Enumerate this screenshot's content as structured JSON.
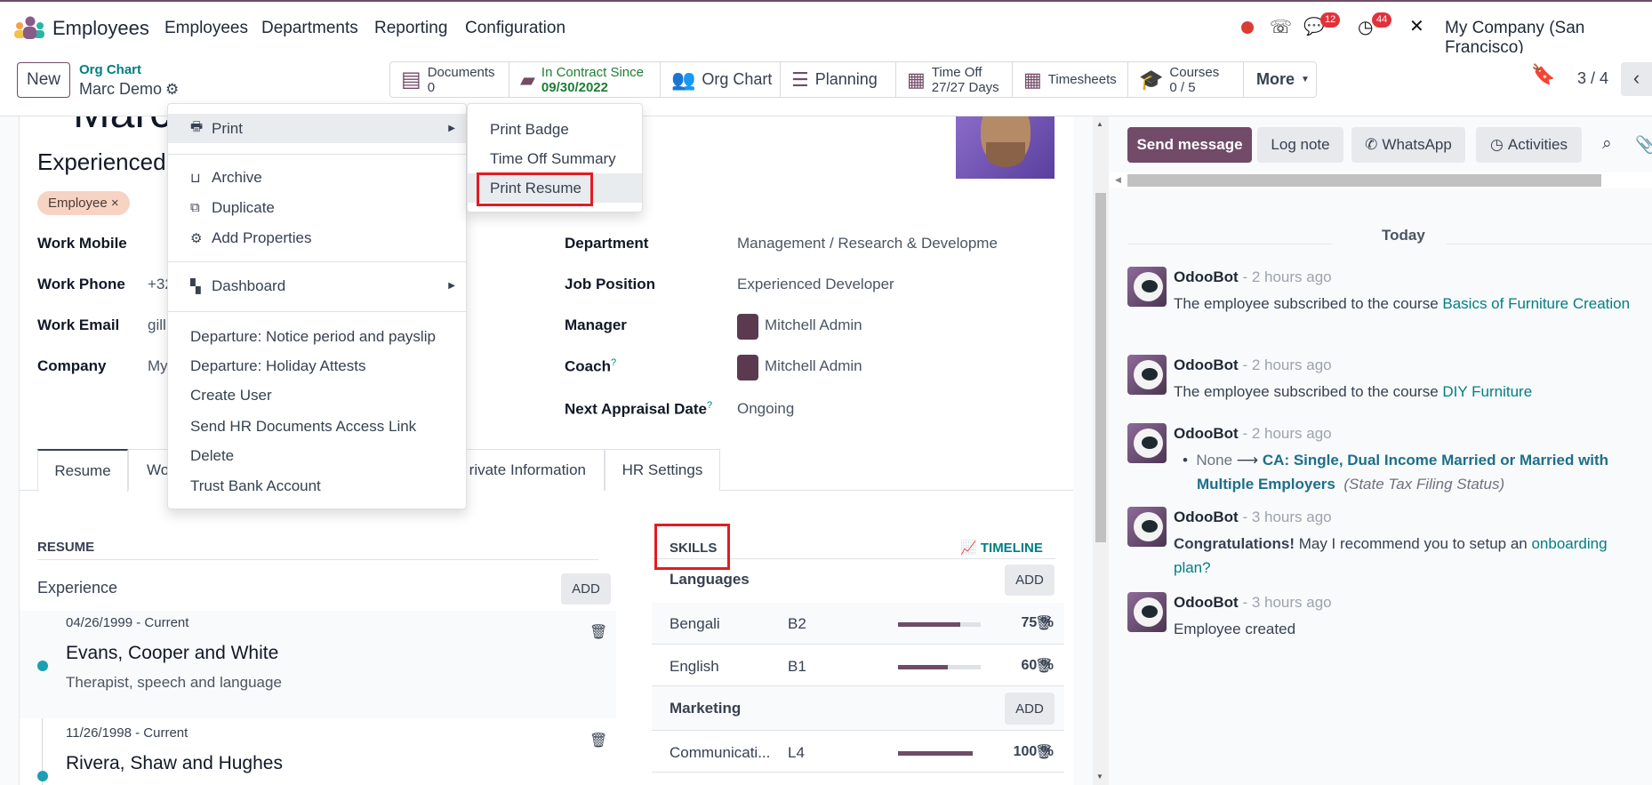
{
  "app": {
    "name": "Employees",
    "menu": [
      "Employees",
      "Departments",
      "Reporting",
      "Configuration"
    ],
    "company": "My Company (San Francisco)",
    "badges": {
      "messages": "12",
      "activities": "44"
    },
    "accent": "#714b67",
    "link_color": "#017e84"
  },
  "control": {
    "new_label": "New",
    "breadcrumb_parent": "Org Chart",
    "breadcrumb_current": "Marc Demo",
    "pager": "3 / 4"
  },
  "smart_buttons": [
    {
      "label": "Documents",
      "value": "0",
      "icon": "file-icon"
    },
    {
      "label": "In Contract Since",
      "value": "09/30/2022",
      "icon": "book-icon"
    },
    {
      "label": "Org Chart",
      "icon": "users-icon"
    },
    {
      "label": "Planning",
      "icon": "tasks-icon"
    },
    {
      "label": "Time Off",
      "value": "27/27 Days",
      "icon": "calendar-icon"
    },
    {
      "label": "Timesheets",
      "icon": "calendar-icon"
    },
    {
      "label": "Courses",
      "value": "0 / 5",
      "icon": "graduation-cap-icon"
    },
    {
      "label": "More"
    }
  ],
  "employee": {
    "name": "Marc Demo",
    "job_title": "Experienced",
    "tag": "Employee",
    "left_fields": [
      {
        "label": "Work Mobile",
        "value": ""
      },
      {
        "label": "Work Phone",
        "value": "+32"
      },
      {
        "label": "Work Email",
        "value": "gill"
      },
      {
        "label": "Company",
        "value": "My"
      }
    ],
    "right_fields": [
      {
        "label": "Department",
        "value": "Management / Research & Developme"
      },
      {
        "label": "Job Position",
        "value": "Experienced Developer"
      },
      {
        "label": "Manager",
        "value": "Mitchell Admin"
      },
      {
        "label": "Coach",
        "value": "Mitchell Admin",
        "help": "?"
      },
      {
        "label": "Next Appraisal Date",
        "value": "Ongoing",
        "help": "?"
      }
    ]
  },
  "tabs": [
    "Resume",
    "Wo",
    "rivate Information",
    "HR Settings"
  ],
  "resume": {
    "title": "RESUME",
    "section": "Experience",
    "add": "ADD",
    "items": [
      {
        "dates": "04/26/1999 - Current",
        "title": "Evans, Cooper and White",
        "desc": "Therapist, speech and language"
      },
      {
        "dates": "11/26/1998 - Current",
        "title": "Rivera, Shaw and Hughes"
      }
    ]
  },
  "skills": {
    "title": "SKILLS",
    "timeline": "TIMELINE",
    "add": "ADD",
    "groups": [
      {
        "name": "Languages",
        "rows": [
          {
            "skill": "Bengali",
            "level": "B2",
            "progress": 75,
            "pct": "75 %"
          },
          {
            "skill": "English",
            "level": "B1",
            "progress": 60,
            "pct": "60 %"
          }
        ]
      },
      {
        "name": "Marketing",
        "rows": [
          {
            "skill": "Communicati...",
            "level": "L4",
            "progress": 100,
            "pct": "100 %"
          }
        ]
      }
    ]
  },
  "gear_menu": {
    "items": [
      "Print",
      "Archive",
      "Duplicate",
      "Add Properties",
      "Dashboard",
      "Departure: Notice period and payslip",
      "Departure: Holiday Attests",
      "Create User",
      "Send HR Documents Access Link",
      "Delete",
      "Trust Bank Account"
    ],
    "print_submenu": [
      "Print Badge",
      "Time Off Summary",
      "Print Resume"
    ]
  },
  "chatter": {
    "send": "Send message",
    "log": "Log note",
    "whatsapp": "WhatsApp",
    "activities": "Activities",
    "today": "Today",
    "messages": [
      {
        "author": "OdooBot",
        "time": "- 2 hours ago",
        "text": "The employee subscribed to the course ",
        "link": "Basics of Furniture Creation"
      },
      {
        "author": "OdooBot",
        "time": "- 2 hours ago",
        "text": "The employee subscribed to the course ",
        "link": "DIY Furniture"
      },
      {
        "author": "OdooBot",
        "time": "- 2 hours ago",
        "old": "None",
        "new": "CA: Single, Dual Income Married or Married with Multiple Employers",
        "field": "(State Tax Filing Status)"
      },
      {
        "author": "OdooBot",
        "time": "- 3 hours ago",
        "bold": "Congratulations!",
        "text": " May I recommend you to setup an ",
        "link": "onboarding plan?"
      },
      {
        "author": "OdooBot",
        "time": "- 3 hours ago",
        "text": "Employee created"
      }
    ]
  }
}
